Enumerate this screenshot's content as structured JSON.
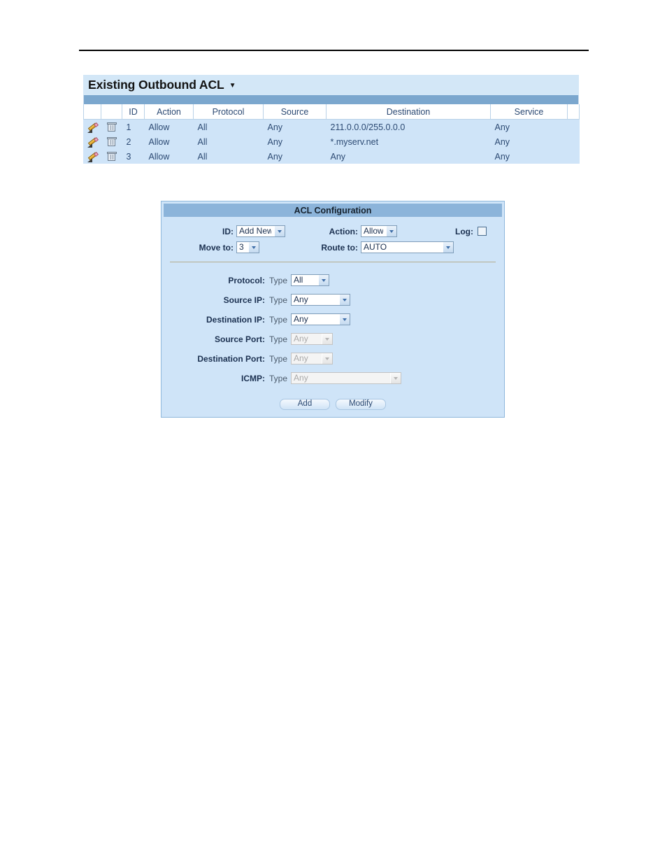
{
  "existing_acl": {
    "title": "Existing Outbound ACL",
    "caret_icon": "caret-down-icon",
    "columns": [
      "",
      "",
      "ID",
      "Action",
      "Protocol",
      "Source",
      "Destination",
      "Service",
      ""
    ],
    "rows": [
      {
        "edit_icon": "pencil-icon",
        "delete_icon": "trash-icon",
        "id": "1",
        "action": "Allow",
        "protocol": "All",
        "source": "Any",
        "destination": "211.0.0.0/255.0.0.0",
        "service": "Any"
      },
      {
        "edit_icon": "pencil-icon",
        "delete_icon": "trash-icon",
        "id": "2",
        "action": "Allow",
        "protocol": "All",
        "source": "Any",
        "destination": "*.myserv.net",
        "service": "Any"
      },
      {
        "edit_icon": "pencil-icon",
        "delete_icon": "trash-icon",
        "id": "3",
        "action": "Allow",
        "protocol": "All",
        "source": "Any",
        "destination": "Any",
        "service": "Any"
      }
    ]
  },
  "acl_config": {
    "header": "ACL Configuration",
    "fields": {
      "id_label": "ID:",
      "id_value": "Add New",
      "action_label": "Action:",
      "action_value": "Allow",
      "log_label": "Log:",
      "log_checked": false,
      "move_to_label": "Move to:",
      "move_to_value": "3",
      "route_to_label": "Route to:",
      "route_to_value": "AUTO",
      "protocol_label": "Protocol:",
      "protocol_type_label": "Type",
      "protocol_value": "All",
      "source_ip_label": "Source IP:",
      "source_ip_type_label": "Type",
      "source_ip_value": "Any",
      "destination_ip_label": "Destination IP:",
      "destination_ip_type_label": "Type",
      "destination_ip_value": "Any",
      "source_port_label": "Source Port:",
      "source_port_type_label": "Type",
      "source_port_value": "Any",
      "destination_port_label": "Destination Port:",
      "destination_port_type_label": "Type",
      "destination_port_value": "Any",
      "icmp_label": "ICMP:",
      "icmp_type_label": "Type",
      "icmp_value": "Any"
    },
    "buttons": {
      "add": "Add",
      "modify": "Modify"
    }
  },
  "colors": {
    "panel_bg": "#cfe4f8",
    "title_bg": "#d3e7f7",
    "subbar": "#7ba7ce",
    "header_bar": "#8cb4da",
    "text": "#2c4a73",
    "label": "#1b3050",
    "divider": "#b3ab8e"
  }
}
